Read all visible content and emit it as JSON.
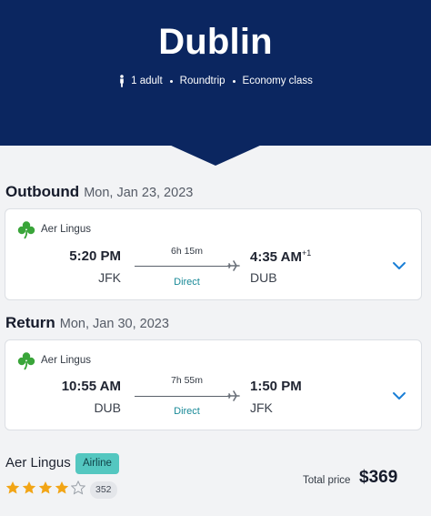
{
  "hero": {
    "city": "Dublin",
    "travellers": "1 adult",
    "trip_type": "Roundtrip",
    "cabin": "Economy class",
    "background_color": "#0b2660"
  },
  "outbound": {
    "label": "Outbound",
    "date": "Mon, Jan 23, 2023",
    "airline": "Aer Lingus",
    "depart_time": "5:20 PM",
    "depart_code": "JFK",
    "duration": "6h 15m",
    "stops": "Direct",
    "arrive_time": "4:35 AM",
    "arrive_day_offset": "+1",
    "arrive_code": "DUB"
  },
  "return": {
    "label": "Return",
    "date": "Mon, Jan 30, 2023",
    "airline": "Aer Lingus",
    "depart_time": "10:55 AM",
    "depart_code": "DUB",
    "duration": "7h 55m",
    "stops": "Direct",
    "arrive_time": "1:50 PM",
    "arrive_day_offset": "",
    "arrive_code": "JFK"
  },
  "summary": {
    "airline": "Aer Lingus",
    "badge": "Airline",
    "rating": 4,
    "rating_max": 5,
    "review_count": "352",
    "total_label": "Total price",
    "total_price": "$369"
  },
  "icons": {
    "logo": "shamrock-icon",
    "plane": "plane-icon",
    "expand": "chevron-down-icon",
    "person": "person-icon",
    "star": "star-icon"
  },
  "colors": {
    "accent": "#1a7fd6",
    "direct": "#1a8a98",
    "badge": "#54c7c0",
    "star": "#f2a516",
    "shamrock": "#3aa53a"
  }
}
